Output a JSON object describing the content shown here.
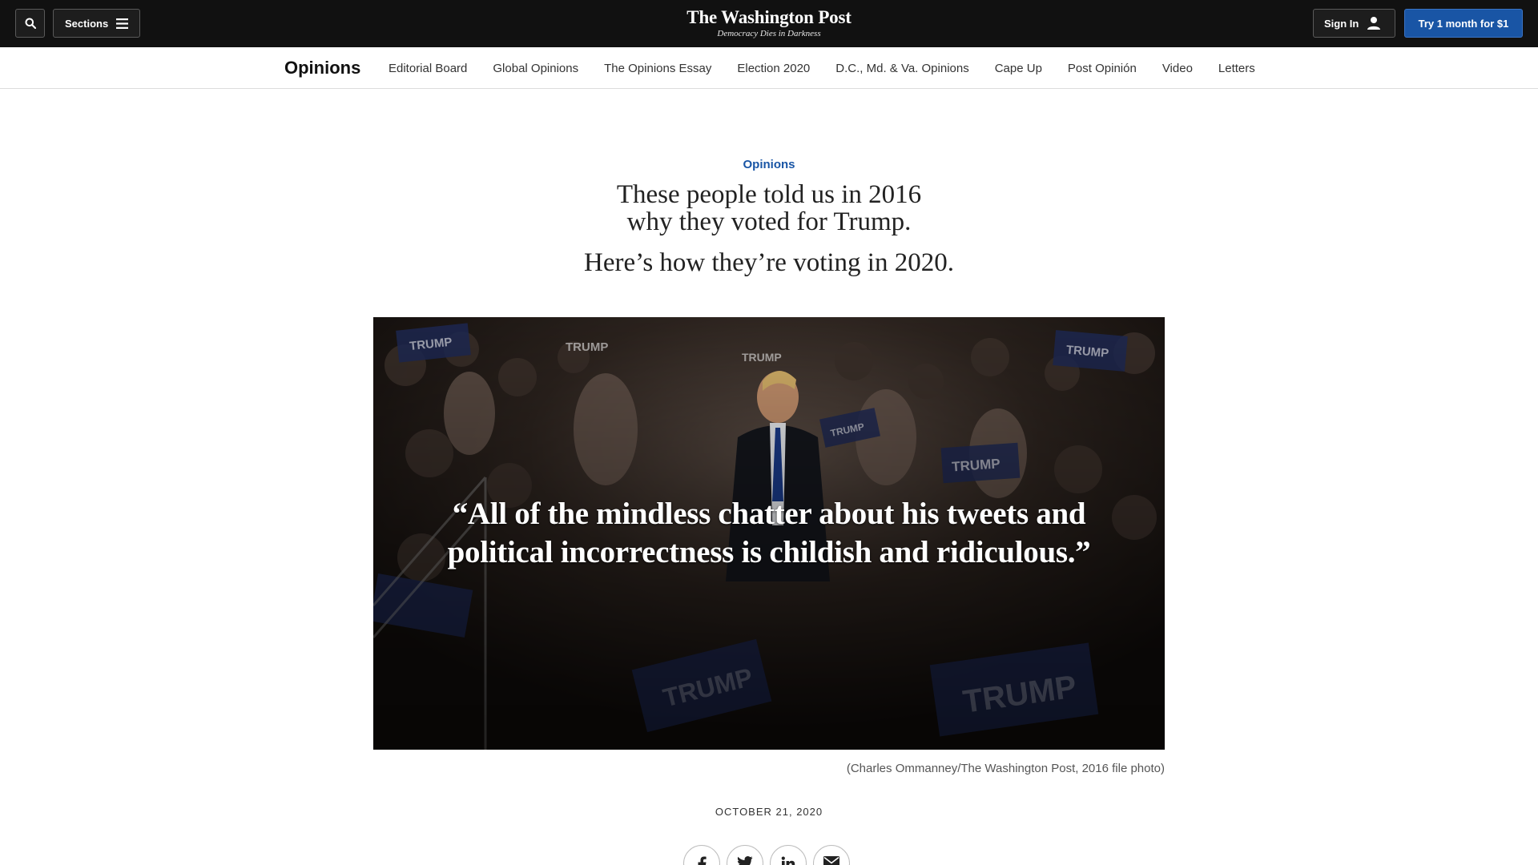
{
  "header": {
    "search_icon": "search-icon",
    "sections_label": "Sections",
    "logo_name": "The Washington Post",
    "logo_tagline": "Democracy Dies in Darkness",
    "signin_label": "Sign In",
    "subscribe_label": "Try 1 month for $1"
  },
  "section_nav": {
    "title": "Opinions",
    "links": [
      "Editorial Board",
      "Global Opinions",
      "The Opinions Essay",
      "Election 2020",
      "D.C., Md. & Va. Opinions",
      "Cape Up",
      "Post Opinión",
      "Video",
      "Letters"
    ]
  },
  "article": {
    "kicker": "Opinions",
    "headline_line1": "These people told us in 2016",
    "headline_line2": "why they voted for Trump.",
    "dek": "Here’s how they’re voting in 2020.",
    "hero_quote_line1": "“All of the mindless chatter about his tweets and",
    "hero_quote_line2": "political incorrectness is childish and ridiculous.”",
    "photo_credit": "(Charles Ommanney/The Washington Post, 2016 file photo)",
    "date": "OCTOBER 21, 2020"
  },
  "share": [
    "facebook-icon",
    "twitter-icon",
    "linkedin-icon",
    "email-icon"
  ],
  "colors": {
    "topbar": "#111111",
    "accent_blue": "#1955a5",
    "text": "#222222"
  }
}
